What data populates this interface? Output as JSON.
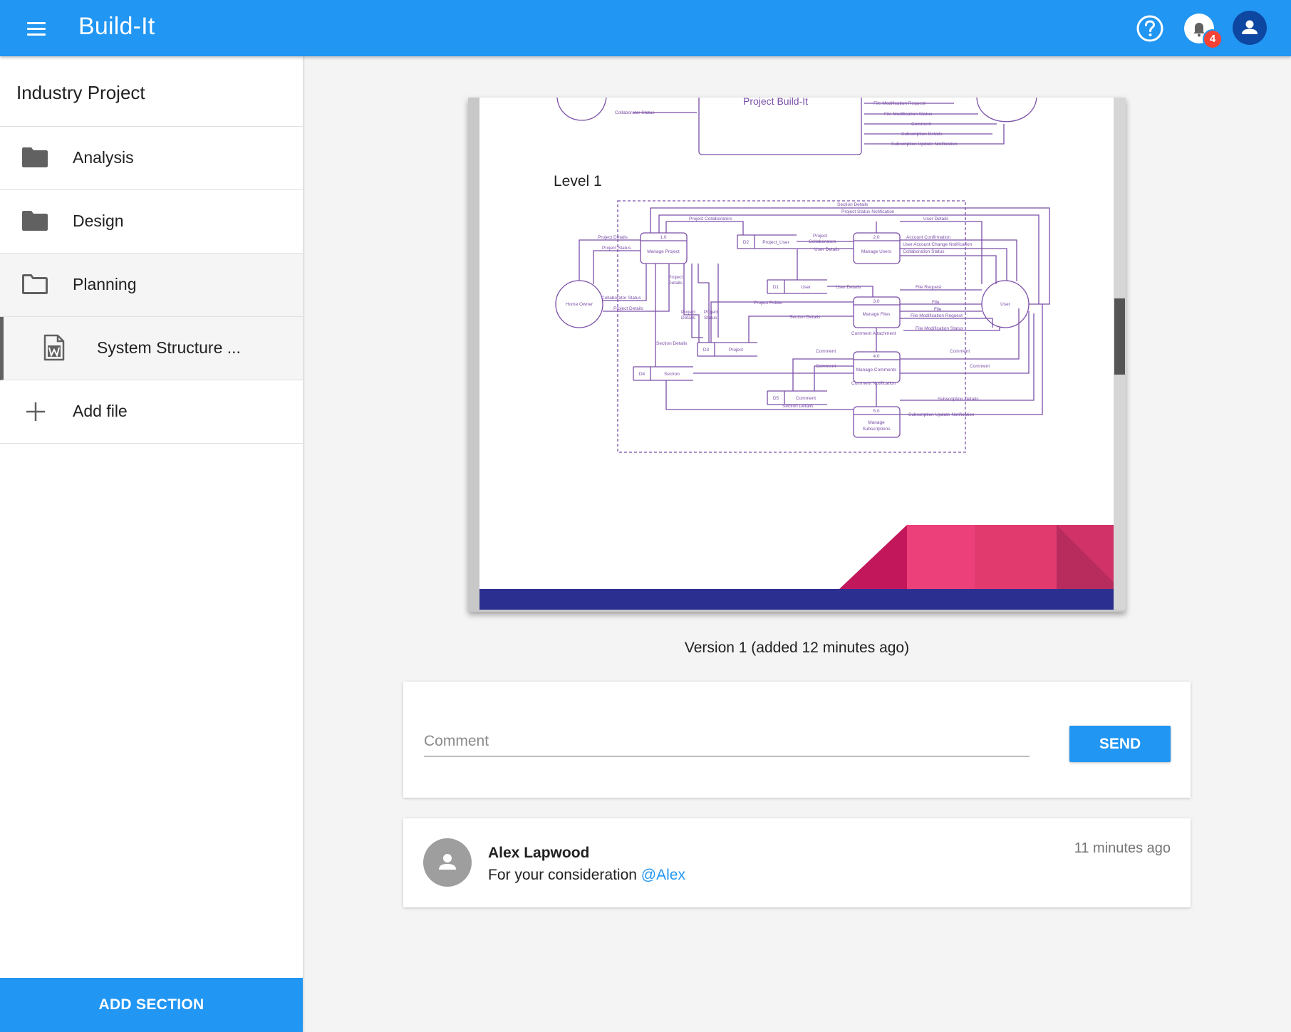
{
  "appbar": {
    "title": "Build-It",
    "notification_count": "4"
  },
  "sidebar": {
    "project_title": "Industry Project",
    "items": [
      {
        "label": "Analysis"
      },
      {
        "label": "Design"
      },
      {
        "label": "Planning"
      },
      {
        "label": "System Structure ..."
      },
      {
        "label": "Add file"
      }
    ],
    "add_section_label": "ADD SECTION"
  },
  "document": {
    "heading_top": "Project Build-It",
    "level_label": "Level 1",
    "version_text": "Version 1 (added 12 minutes ago)",
    "context_flows": [
      "Collaborator Status",
      "File Modification Request",
      "File Modification Status",
      "Comment",
      "Subscription Details",
      "Subscription Update Notification"
    ],
    "processes": [
      {
        "num": "1.0",
        "name": "Manage Project"
      },
      {
        "num": "2.0",
        "name": "Manage Users"
      },
      {
        "num": "3.0",
        "name": "Manage Files"
      },
      {
        "num": "4.0",
        "name": "Manage Comments"
      },
      {
        "num": "5.0",
        "name": "Manage Subscriptions"
      }
    ],
    "stores": [
      {
        "id": "D1",
        "name": "User"
      },
      {
        "id": "D2",
        "name": "Project_User"
      },
      {
        "id": "D3",
        "name": "Project"
      },
      {
        "id": "D4",
        "name": "Section"
      },
      {
        "id": "D5",
        "name": "Comment"
      }
    ],
    "entities": [
      "Home Owner",
      "User"
    ],
    "flows": [
      "Section Details",
      "Project Status Notification",
      "Project Collaborators",
      "User Details",
      "Project Details",
      "Project Status",
      "Account Confirmation",
      "User Account Change Notification",
      "Collaboration Status",
      "File Request",
      "Project Folder",
      "File",
      "File Modification Request",
      "File Modification Status",
      "Comment Attachment",
      "Comment",
      "Comment Notification",
      "Subscription Details",
      "Subscription Update Notification"
    ]
  },
  "comment_form": {
    "placeholder": "Comment",
    "value": "",
    "send_label": "SEND"
  },
  "comments": [
    {
      "author": "Alex Lapwood",
      "text": "For your consideration ",
      "mention": "@Alex",
      "time": "11 minutes ago"
    }
  ],
  "colors": {
    "primary": "#2196f3",
    "diagram": "#7b4fa8",
    "footer_navy": "#2b2f8f",
    "footer_pink": "#ec407a",
    "badge": "#f44336"
  }
}
